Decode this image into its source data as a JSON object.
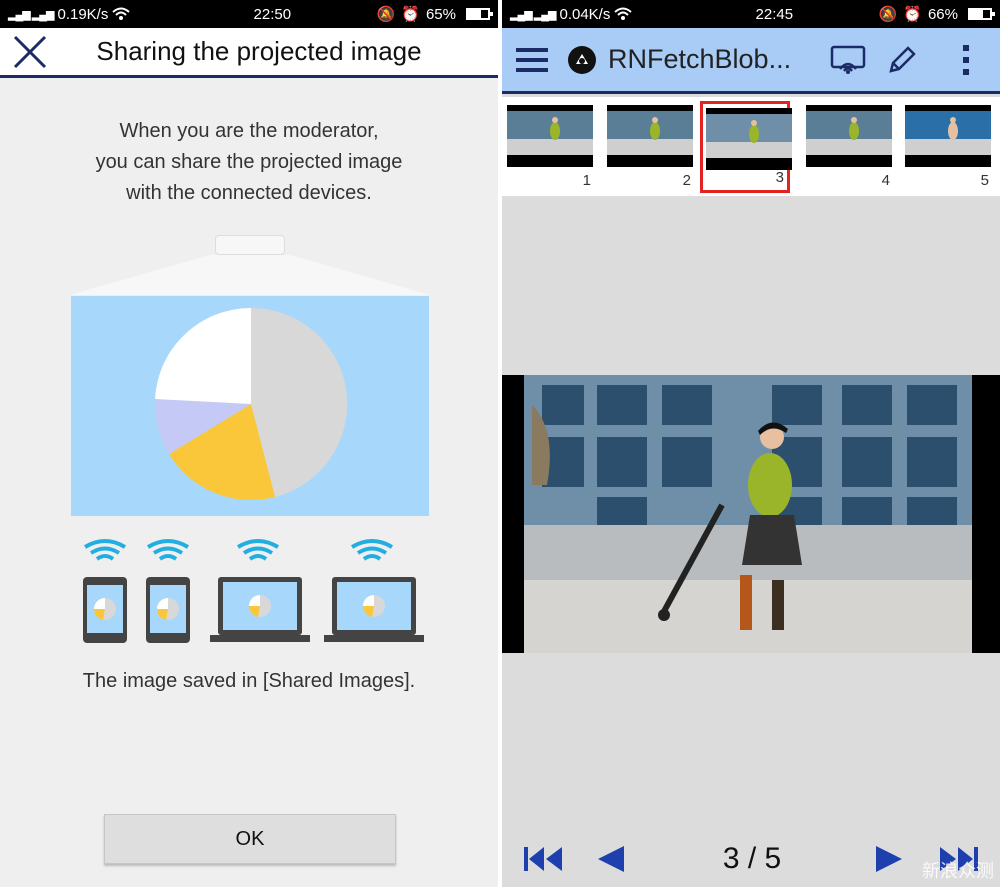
{
  "left": {
    "status": {
      "network": "0.19K/s",
      "time": "22:50",
      "battery": "65%",
      "battery_level": 0.65
    },
    "header": {
      "title": "Sharing the projected image"
    },
    "description": [
      "When you are the moderator,",
      "you can share the projected image",
      "with the connected devices."
    ],
    "footnote": "The image saved in [Shared Images].",
    "ok_label": "OK"
  },
  "right": {
    "status": {
      "network": "0.04K/s",
      "time": "22:45",
      "battery": "66%",
      "battery_level": 0.66
    },
    "app_title": "RNFetchBlob...",
    "thumbnails": [
      {
        "num": "1",
        "selected": false
      },
      {
        "num": "2",
        "selected": false
      },
      {
        "num": "3",
        "selected": true
      },
      {
        "num": "4",
        "selected": false
      },
      {
        "num": "5",
        "selected": false
      }
    ],
    "pager": "3 / 5",
    "watermark": "新浪众测"
  },
  "colors": {
    "accent_dark": "#1c2a66",
    "appbar": "#a9ccf7",
    "screen": "#a7d8fb",
    "nav_blue": "#1e3fae",
    "selected_border": "#e32222"
  }
}
